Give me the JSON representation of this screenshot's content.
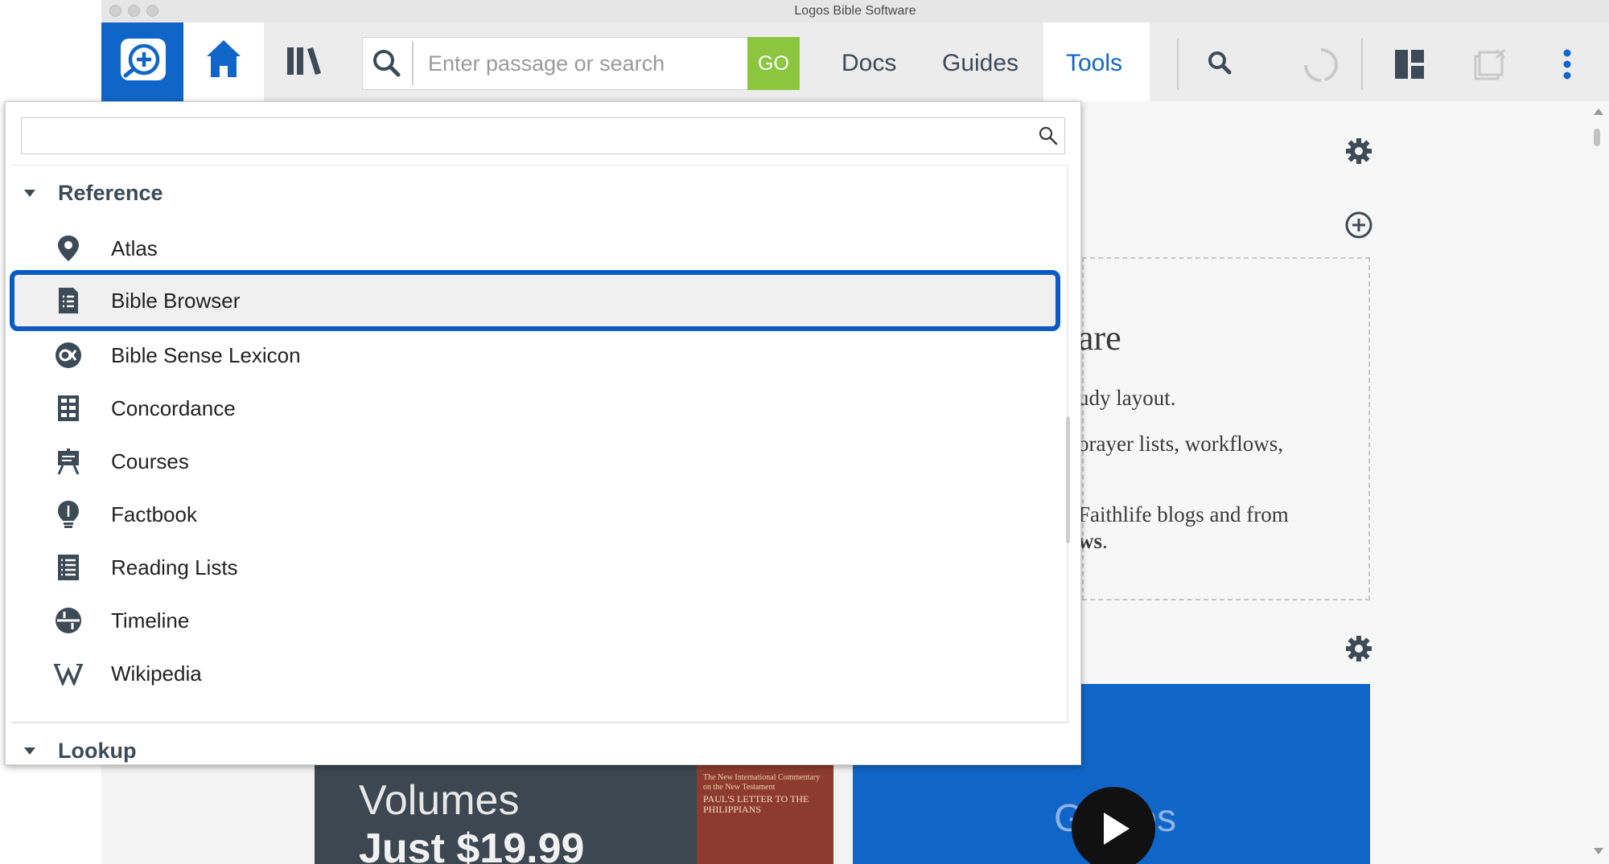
{
  "window": {
    "title": "Logos Bible Software"
  },
  "toolbar": {
    "search_placeholder": "Enter passage or search",
    "go_label": "GO",
    "docs_label": "Docs",
    "guides_label": "Guides",
    "tools_label": "Tools",
    "active_tab": "Tools"
  },
  "tools_menu": {
    "filter_value": "",
    "sections": [
      {
        "label": "Reference",
        "expanded": true,
        "items": [
          {
            "label": "Atlas",
            "icon": "map-pin-icon"
          },
          {
            "label": "Bible Browser",
            "icon": "bible-browser-icon",
            "selected": true
          },
          {
            "label": "Bible Sense Lexicon",
            "icon": "lexicon-icon"
          },
          {
            "label": "Concordance",
            "icon": "concordance-icon"
          },
          {
            "label": "Courses",
            "icon": "courses-icon"
          },
          {
            "label": "Factbook",
            "icon": "factbook-icon"
          },
          {
            "label": "Reading Lists",
            "icon": "reading-list-icon"
          },
          {
            "label": "Timeline",
            "icon": "timeline-icon"
          },
          {
            "label": "Wikipedia",
            "icon": "wikipedia-icon"
          }
        ]
      },
      {
        "label": "Lookup",
        "expanded": true,
        "items": []
      }
    ]
  },
  "background": {
    "card_heading_partial": "are",
    "card_line1": "udy layout.",
    "card_line2": "orayer lists, workflows,",
    "card_line3": "Faithlife blogs and from",
    "card_line4_bold": "ws",
    "card_line4_end": ".",
    "promo_line1": "Volumes",
    "promo_line2": "Just $19.99",
    "book_series": "The New International Commentary on the New Testament",
    "book_title": "PAUL'S LETTER TO THE PHILIPPIANS",
    "guides_video_label": "Guides"
  },
  "colors": {
    "brand_blue": "#1066c8",
    "go_green": "#8cc63f",
    "selection_outline": "#0a5bc4",
    "icon_slate": "#3d4a57"
  }
}
